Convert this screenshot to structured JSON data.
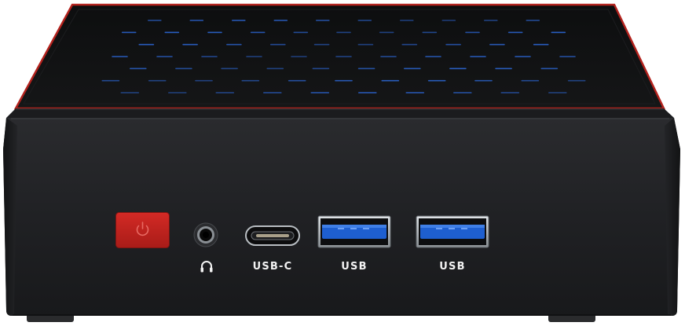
{
  "device": {
    "ports": {
      "usb_c_label": "USB-C",
      "usb_1_label": "USB",
      "usb_2_label": "USB"
    },
    "colors": {
      "body": "#1e1f21",
      "top_panel": "#101112",
      "accent_trim": "#b3221d",
      "power_button": "#c4231f",
      "vent_light": "#2f6fe8",
      "usb3_tongue": "#1e5fd0",
      "label_text": "#f2f2f2"
    },
    "icons": {
      "power_button": "power-icon",
      "audio_jack": "headphone-icon"
    }
  }
}
